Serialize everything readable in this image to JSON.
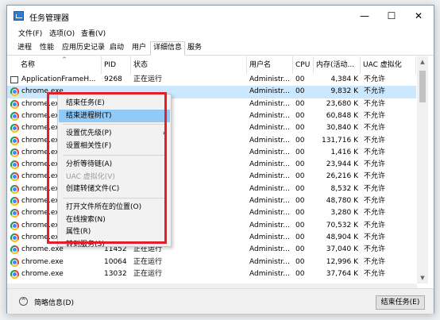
{
  "window": {
    "title": "任务管理器",
    "minimize": "—",
    "maximize": "☐",
    "close": "✕"
  },
  "menu": [
    "文件(F)",
    "选项(O)",
    "查看(V)"
  ],
  "tabs": [
    "进程",
    "性能",
    "应用历史记录",
    "启动",
    "用户",
    "详细信息",
    "服务"
  ],
  "active_tab": "详细信息",
  "columns": {
    "name": "名称",
    "pid": "PID",
    "status": "状态",
    "user": "用户名",
    "cpu": "CPU",
    "mem": "内存(活动...",
    "uac": "UAC 虚拟化"
  },
  "rows": [
    {
      "icon": "app-icon",
      "name": "ApplicationFrameH...",
      "pid": "9268",
      "status": "正在运行",
      "user": "Administr...",
      "cpu": "00",
      "mem": "4,384 K",
      "uac": "不允许"
    },
    {
      "icon": "chrome-icon",
      "name": "chrome.exe",
      "pid": "",
      "status": "",
      "user": "Administr...",
      "cpu": "00",
      "mem": "9,832 K",
      "uac": "不允许",
      "selected": true
    },
    {
      "icon": "chrome-icon",
      "name": "chrome.exe",
      "pid": "",
      "status": "",
      "user": "Administr...",
      "cpu": "00",
      "mem": "23,680 K",
      "uac": "不允许"
    },
    {
      "icon": "chrome-icon",
      "name": "chrome.exe",
      "pid": "",
      "status": "",
      "user": "Administr...",
      "cpu": "00",
      "mem": "60,848 K",
      "uac": "不允许"
    },
    {
      "icon": "chrome-icon",
      "name": "chrome.exe",
      "pid": "",
      "status": "",
      "user": "Administr...",
      "cpu": "00",
      "mem": "30,840 K",
      "uac": "不允许"
    },
    {
      "icon": "chrome-icon",
      "name": "chrome.exe",
      "pid": "",
      "status": "",
      "user": "Administr...",
      "cpu": "00",
      "mem": "131,716 K",
      "uac": "不允许"
    },
    {
      "icon": "chrome-icon",
      "name": "chrome.exe",
      "pid": "",
      "status": "",
      "user": "Administr...",
      "cpu": "00",
      "mem": "1,416 K",
      "uac": "不允许"
    },
    {
      "icon": "chrome-icon",
      "name": "chrome.exe",
      "pid": "",
      "status": "",
      "user": "Administr...",
      "cpu": "00",
      "mem": "23,944 K",
      "uac": "不允许"
    },
    {
      "icon": "chrome-icon",
      "name": "chrome.exe",
      "pid": "",
      "status": "",
      "user": "Administr...",
      "cpu": "00",
      "mem": "26,216 K",
      "uac": "不允许"
    },
    {
      "icon": "chrome-icon",
      "name": "chrome.exe",
      "pid": "",
      "status": "",
      "user": "Administr...",
      "cpu": "00",
      "mem": "8,532 K",
      "uac": "不允许"
    },
    {
      "icon": "chrome-icon",
      "name": "chrome.exe",
      "pid": "",
      "status": "",
      "user": "Administr...",
      "cpu": "00",
      "mem": "48,780 K",
      "uac": "不允许"
    },
    {
      "icon": "chrome-icon",
      "name": "chrome.exe",
      "pid": "",
      "status": "",
      "user": "Administr...",
      "cpu": "00",
      "mem": "3,280 K",
      "uac": "不允许"
    },
    {
      "icon": "chrome-icon",
      "name": "chrome.exe",
      "pid": "",
      "status": "",
      "user": "Administr...",
      "cpu": "00",
      "mem": "70,532 K",
      "uac": "不允许"
    },
    {
      "icon": "chrome-icon",
      "name": "chrome.exe",
      "pid": "",
      "status": "",
      "user": "Administr...",
      "cpu": "00",
      "mem": "48,904 K",
      "uac": "不允许"
    },
    {
      "icon": "chrome-icon",
      "name": "chrome.exe",
      "pid": "11452",
      "status": "正在运行",
      "user": "Administr...",
      "cpu": "00",
      "mem": "37,040 K",
      "uac": "不允许"
    },
    {
      "icon": "chrome-icon",
      "name": "chrome.exe",
      "pid": "10064",
      "status": "正在运行",
      "user": "Administr...",
      "cpu": "00",
      "mem": "12,996 K",
      "uac": "不允许"
    },
    {
      "icon": "chrome-icon",
      "name": "chrome.exe",
      "pid": "13032",
      "status": "正在运行",
      "user": "Administr...",
      "cpu": "00",
      "mem": "37,764 K",
      "uac": "不允许"
    }
  ],
  "context_menu": {
    "items": [
      {
        "label": "结束任务(E)",
        "highlight": false,
        "disabled": false
      },
      {
        "label": "结束进程树(T)",
        "highlight": true,
        "disabled": false
      },
      {
        "sep": true
      },
      {
        "label": "设置优先级(P)",
        "highlight": false,
        "disabled": false,
        "submenu": true
      },
      {
        "label": "设置相关性(F)",
        "highlight": false,
        "disabled": false
      },
      {
        "sep": true
      },
      {
        "label": "分析等待链(A)",
        "highlight": false,
        "disabled": false
      },
      {
        "label": "UAC 虚拟化(V)",
        "highlight": false,
        "disabled": true
      },
      {
        "label": "创建转储文件(C)",
        "highlight": false,
        "disabled": false
      },
      {
        "sep": true
      },
      {
        "label": "打开文件所在的位置(O)",
        "highlight": false,
        "disabled": false
      },
      {
        "label": "在线搜索(N)",
        "highlight": false,
        "disabled": false
      },
      {
        "label": "属性(R)",
        "highlight": false,
        "disabled": false
      },
      {
        "label": "转到服务(S)",
        "highlight": false,
        "disabled": false
      }
    ]
  },
  "footer": {
    "collapse_label": "简略信息(D)",
    "end_task_label": "结束任务(E)"
  },
  "colors": {
    "selection": "#cce8ff",
    "menu_highlight": "#91c9f7",
    "annotation_box": "#e41e26"
  }
}
